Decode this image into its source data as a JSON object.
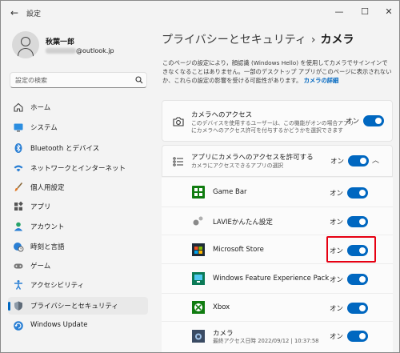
{
  "window": {
    "title": "設定",
    "back_glyph": "←",
    "controls": {
      "minimize": "—",
      "maximize": "☐",
      "close": "✕"
    }
  },
  "profile": {
    "name": "秋葉一郎",
    "email_suffix": "@outlook.jp"
  },
  "search": {
    "placeholder": "設定の検索"
  },
  "nav": {
    "items": [
      {
        "label": "ホーム",
        "icon": "home-icon"
      },
      {
        "label": "システム",
        "icon": "monitor-icon"
      },
      {
        "label": "Bluetooth とデバイス",
        "icon": "bluetooth-icon"
      },
      {
        "label": "ネットワークとインターネット",
        "icon": "wifi-icon"
      },
      {
        "label": "個人用設定",
        "icon": "brush-icon"
      },
      {
        "label": "アプリ",
        "icon": "apps-icon"
      },
      {
        "label": "アカウント",
        "icon": "account-icon"
      },
      {
        "label": "時刻と言語",
        "icon": "globe-clock-icon"
      },
      {
        "label": "ゲーム",
        "icon": "gamepad-icon"
      },
      {
        "label": "アクセシビリティ",
        "icon": "accessibility-icon"
      },
      {
        "label": "プライバシーとセキュリティ",
        "icon": "shield-icon",
        "active": true
      },
      {
        "label": "Windows Update",
        "icon": "update-icon"
      }
    ]
  },
  "main": {
    "breadcrumb_parent": "プライバシーとセキュリティ",
    "breadcrumb_sep": "›",
    "page_title": "カメラ",
    "description": "このページの設定により，顔認識 (Windows Hello) を使用してカメラでサインインできなくなることはありません。一部のデスクトップ アプリがこのページに表示されないか、これらの設定の影響を受ける可能性があります。",
    "description_link": "カメラの詳細",
    "camera_access": {
      "title": "カメラへのアクセス",
      "subtitle_line1": "このデバイスを使用するユーザーは、この機能がオンの場合アプリ",
      "subtitle_line2": "にカメラへのアクセス許可を付与するかどうかを選択できます",
      "state": "オン"
    },
    "app_access": {
      "title": "アプリにカメラへのアクセスを許可する",
      "subtitle": "カメラにアクセスできるアプリの選択",
      "state": "オン",
      "chevron": "︿"
    },
    "apps": [
      {
        "name": "Game Bar",
        "state": "オン",
        "icon": "gamebar-icon"
      },
      {
        "name": "LAVIEかんたん設定",
        "state": "オン",
        "icon": "lavie-icon"
      },
      {
        "name": "Microsoft Store",
        "state": "オン",
        "icon": "store-icon"
      },
      {
        "name": "Windows Feature Experience Pack",
        "state": "オン",
        "icon": "feature-pack-icon"
      },
      {
        "name": "Xbox",
        "state": "オン",
        "icon": "xbox-icon"
      },
      {
        "name": "カメラ",
        "sub": "最終アクセス日時 2022/09/12 | 10:37:58",
        "state": "オン",
        "icon": "camera-app-icon"
      }
    ]
  },
  "colors": {
    "accent": "#0067c0",
    "highlight": "#e60012"
  }
}
